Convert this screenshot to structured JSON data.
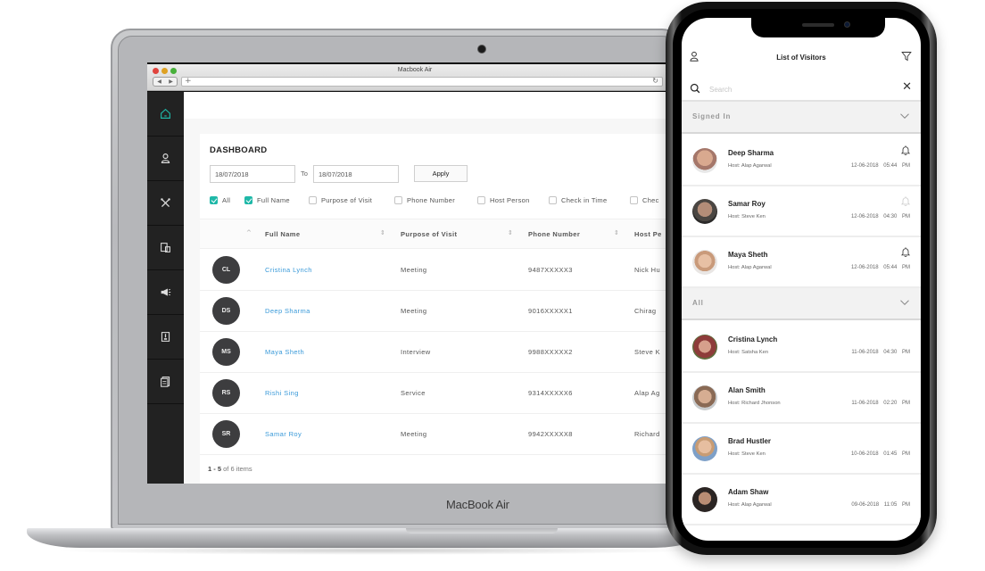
{
  "laptop": {
    "brand_label": "MacBook Air",
    "browser": {
      "window_title": "Macbook Air",
      "back_label": "◀",
      "forward_label": "▶",
      "new_tab_label": "+",
      "reload_label": "↻"
    },
    "sidebar": {
      "items": [
        {
          "icon": "home-icon",
          "active": true
        },
        {
          "icon": "user-icon",
          "active": false
        },
        {
          "icon": "tools-icon",
          "active": false
        },
        {
          "icon": "devices-icon",
          "active": false
        },
        {
          "icon": "megaphone-icon",
          "active": false
        },
        {
          "icon": "badge-icon",
          "active": false
        },
        {
          "icon": "reports-icon",
          "active": false
        }
      ]
    },
    "dashboard": {
      "title": "DASHBOARD",
      "date_from": "18/07/2018",
      "to_label": "To",
      "date_to": "18/07/2018",
      "apply_label": "Apply",
      "filters": [
        {
          "label": "All",
          "checked": true
        },
        {
          "label": "Full Name",
          "checked": true
        },
        {
          "label": "Purpose of Visit",
          "checked": false
        },
        {
          "label": "Phone Number",
          "checked": false
        },
        {
          "label": "Host Person",
          "checked": false
        },
        {
          "label": "Check in Time",
          "checked": false
        },
        {
          "label": "Chec",
          "checked": false
        }
      ],
      "table": {
        "sort_up_glyph": "^",
        "sort_glyph": "⇕",
        "columns": [
          "Full Name",
          "Purpose of Visit",
          "Phone Number",
          "Host Pe"
        ],
        "rows": [
          {
            "initials": "CL",
            "name": "Cristina Lynch",
            "purpose": "Meeting",
            "phone": "9487XXXXX3",
            "host": "Nick Hu"
          },
          {
            "initials": "DS",
            "name": "Deep Sharma",
            "purpose": "Meeting",
            "phone": "9016XXXXX1",
            "host": "Chirag"
          },
          {
            "initials": "MS",
            "name": "Maya Sheth",
            "purpose": "Interview",
            "phone": "9988XXXXX2",
            "host": "Steve K"
          },
          {
            "initials": "RS",
            "name": "Rishi Sing",
            "purpose": "Service",
            "phone": "9314XXXXX6",
            "host": "Alap Ag"
          },
          {
            "initials": "SR",
            "name": "Samar Roy",
            "purpose": "Meeting",
            "phone": "9942XXXXX8",
            "host": "Richard"
          }
        ]
      },
      "pager": {
        "range": "1 - 5",
        "rest": "of 6 items"
      }
    },
    "colors": {
      "accent": "#1fb8a8",
      "link": "#3a9ad9",
      "sidebar": "#222222",
      "avatar": "#3d3d3f"
    }
  },
  "phone": {
    "title": "List of Visitors",
    "search_placeholder": "Search",
    "clear_label": "✕",
    "sections": [
      {
        "label": "Signed In",
        "items": [
          {
            "name": "Deep Sharma",
            "host": "Host: Alap Agarwal",
            "datetime": "12-06-2018 05:44 PM",
            "bell": "active",
            "photo_color": "#a5776a"
          },
          {
            "name": "Samar Roy",
            "host": "Host: Steve Ken",
            "datetime": "12-06-2018 04:30 PM",
            "bell": "muted",
            "photo_color": "#4a4642"
          },
          {
            "name": "Maya Sheth",
            "host": "Host: Alap Agarwal",
            "datetime": "12-06-2018 05:44 PM",
            "bell": "active",
            "photo_color": "#c99a7a"
          }
        ]
      },
      {
        "label": "All",
        "items": [
          {
            "name": "Cristina Lynch",
            "host": "Host: Satsha Ken",
            "datetime": "11-06-2018 04:30 PM",
            "photo_color": "#8e3c3a"
          },
          {
            "name": "Alan Smith",
            "host": "Host: Richard Jhonson",
            "datetime": "11-06-2018 02:20 PM",
            "photo_color": "#8a6a55"
          },
          {
            "name": "Brad Hustler",
            "host": "Host: Steve Ken",
            "datetime": "10-06-2018 01:45 PM",
            "photo_color": "#c89c74"
          },
          {
            "name": "Adam Shaw",
            "host": "Host: Alap Agarwal",
            "datetime": "09-06-2018 11:05 PM",
            "photo_color": "#2b2523"
          }
        ]
      }
    ]
  }
}
